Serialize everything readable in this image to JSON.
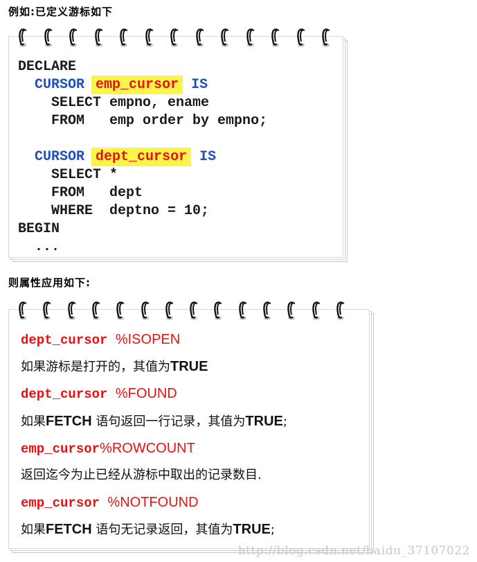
{
  "headings": {
    "example": "例如:已定义游标如下",
    "apply": "则属性应用如下:"
  },
  "code_block": {
    "lines": [
      {
        "indent": "",
        "parts": [
          {
            "text": "DECLARE",
            "style": "plain"
          }
        ]
      },
      {
        "indent": "  ",
        "parts": [
          {
            "text": "CURSOR",
            "style": "blue"
          },
          {
            "text": " ",
            "style": "plain"
          },
          {
            "text": "emp_cursor",
            "style": "highlight"
          },
          {
            "text": " IS",
            "style": "blue"
          }
        ]
      },
      {
        "indent": "    ",
        "parts": [
          {
            "text": "SELECT empno, ename",
            "style": "plain"
          }
        ]
      },
      {
        "indent": "    ",
        "parts": [
          {
            "text": "FROM   emp order by empno;",
            "style": "plain"
          }
        ]
      },
      {
        "indent": "",
        "parts": [
          {
            "text": "",
            "style": "plain"
          }
        ]
      },
      {
        "indent": "  ",
        "parts": [
          {
            "text": "CURSOR",
            "style": "blue"
          },
          {
            "text": " ",
            "style": "plain"
          },
          {
            "text": "dept_cursor",
            "style": "highlight"
          },
          {
            "text": " IS",
            "style": "blue"
          }
        ]
      },
      {
        "indent": "    ",
        "parts": [
          {
            "text": "SELECT *",
            "style": "plain"
          }
        ]
      },
      {
        "indent": "    ",
        "parts": [
          {
            "text": "FROM   dept",
            "style": "plain"
          }
        ]
      },
      {
        "indent": "    ",
        "parts": [
          {
            "text": "WHERE  deptno = 10;",
            "style": "plain"
          }
        ]
      },
      {
        "indent": "",
        "parts": [
          {
            "text": "BEGIN",
            "style": "plain"
          }
        ]
      },
      {
        "indent": "  ",
        "parts": [
          {
            "text": "...",
            "style": "plain"
          }
        ]
      }
    ]
  },
  "attributes": [
    {
      "cursor": "dept_cursor ",
      "attr": "%ISOPEN",
      "desc_pre": "如果游标是打开的，其值为",
      "desc_bold1": "",
      "desc_mid": "",
      "desc_bold2": "TRUE",
      "desc_post": ""
    },
    {
      "cursor": "dept_cursor ",
      "attr": "%FOUND",
      "desc_pre": "如果",
      "desc_bold1": "FETCH",
      "desc_mid": " 语句返回一行记录，其值为",
      "desc_bold2": "TRUE",
      "desc_post": ";"
    },
    {
      "cursor": "emp_cursor",
      "attr": "%ROWCOUNT",
      "desc_pre": "返回迄今为止已经从游标中取出的记录数目.",
      "desc_bold1": "",
      "desc_mid": "",
      "desc_bold2": "",
      "desc_post": ""
    },
    {
      "cursor": "emp_cursor ",
      "attr": "%NOTFOUND",
      "desc_pre": "如果",
      "desc_bold1": "FETCH",
      "desc_mid": " 语句无记录返回，其值为",
      "desc_bold2": "TRUE",
      "desc_post": ";"
    }
  ],
  "watermark": "http://blog.csdn.net/baidu_37107022",
  "colors": {
    "keyword_blue": "#1f4fb8",
    "cursor_red": "#e81010",
    "highlight_yellow": "#fbf54a"
  },
  "icons": {
    "ring": "spiral-ring-icon"
  }
}
